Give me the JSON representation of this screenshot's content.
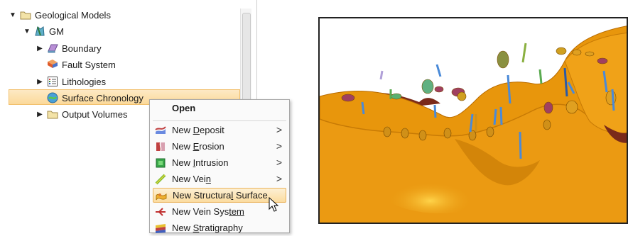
{
  "tree": {
    "root": "Geological Models",
    "model": "GM",
    "items": [
      {
        "label": "Boundary"
      },
      {
        "label": "Fault System"
      },
      {
        "label": "Lithologies"
      },
      {
        "label": "Surface Chronology"
      },
      {
        "label": "Output Volumes"
      }
    ]
  },
  "context_menu": {
    "open": "Open",
    "items": [
      {
        "pre": "New ",
        "ul": "D",
        "post": "eposit",
        "submenu": true
      },
      {
        "pre": "New ",
        "ul": "E",
        "post": "rosion",
        "submenu": true
      },
      {
        "pre": "New ",
        "ul": "I",
        "post": "ntrusion",
        "submenu": true
      },
      {
        "pre": "New Vei",
        "ul": "n",
        "post": "",
        "submenu": true
      },
      {
        "pre": "New Structura",
        "ul": "l",
        "post": " Surface",
        "submenu": false
      },
      {
        "pre": "New Vein Sys",
        "ul": "tem",
        "post": "",
        "submenu": false
      },
      {
        "pre": "New ",
        "ul": "S",
        "post": "tratigraphy",
        "submenu": false
      }
    ]
  },
  "colors": {
    "selection": "#fbd99a",
    "surface": "#e8960c",
    "surface_dark": "#b86b00"
  },
  "icons": {
    "folder": "folder-icon",
    "model": "geomodel-icon",
    "boundary": "boundary-icon",
    "fault": "fault-system-icon",
    "lithologies": "lithologies-icon",
    "chronology": "surface-chronology-icon"
  }
}
